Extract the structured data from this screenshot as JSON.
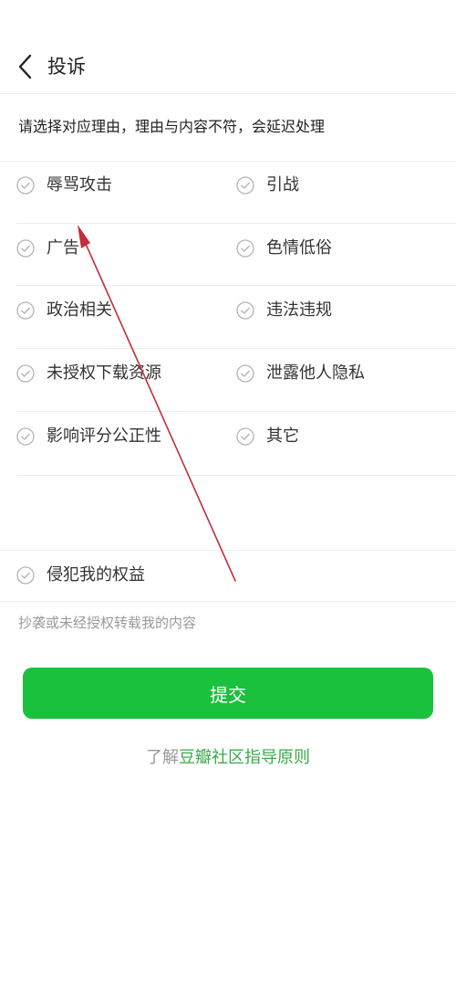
{
  "header": {
    "title": "投诉"
  },
  "hint": "请选择对应理由，理由与内容不符，会延迟处理",
  "reasons": [
    {
      "label": "辱骂攻击"
    },
    {
      "label": "引战"
    },
    {
      "label": "广告"
    },
    {
      "label": "色情低俗"
    },
    {
      "label": "政治相关"
    },
    {
      "label": "违法违规"
    },
    {
      "label": "未授权下载资源"
    },
    {
      "label": "泄露他人隐私"
    },
    {
      "label": "影响评分公正性"
    },
    {
      "label": "其它"
    }
  ],
  "rights": {
    "label": "侵犯我的权益",
    "description": "抄袭或未经授权转载我的内容"
  },
  "submit_label": "提交",
  "guide": {
    "prefix": "了解",
    "link": "豆瓣社区指导原则"
  },
  "colors": {
    "primary_green": "#19c13c",
    "link_green": "#3aa84a",
    "annotation_red": "#c0303a"
  }
}
